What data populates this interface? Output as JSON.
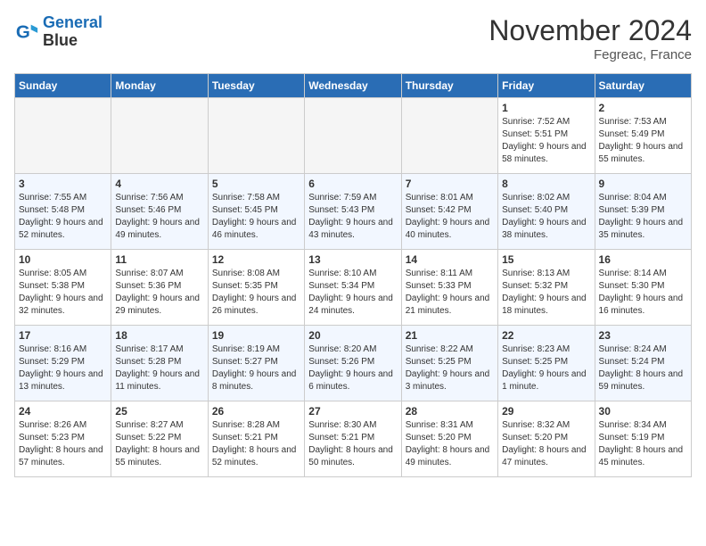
{
  "header": {
    "logo_line1": "General",
    "logo_line2": "Blue",
    "month": "November 2024",
    "location": "Fegreac, France"
  },
  "days_of_week": [
    "Sunday",
    "Monday",
    "Tuesday",
    "Wednesday",
    "Thursday",
    "Friday",
    "Saturday"
  ],
  "weeks": [
    [
      {
        "day": "",
        "empty": true
      },
      {
        "day": "",
        "empty": true
      },
      {
        "day": "",
        "empty": true
      },
      {
        "day": "",
        "empty": true
      },
      {
        "day": "",
        "empty": true
      },
      {
        "day": "1",
        "sunrise": "7:52 AM",
        "sunset": "5:51 PM",
        "daylight": "9 hours and 58 minutes."
      },
      {
        "day": "2",
        "sunrise": "7:53 AM",
        "sunset": "5:49 PM",
        "daylight": "9 hours and 55 minutes."
      }
    ],
    [
      {
        "day": "3",
        "sunrise": "7:55 AM",
        "sunset": "5:48 PM",
        "daylight": "9 hours and 52 minutes."
      },
      {
        "day": "4",
        "sunrise": "7:56 AM",
        "sunset": "5:46 PM",
        "daylight": "9 hours and 49 minutes."
      },
      {
        "day": "5",
        "sunrise": "7:58 AM",
        "sunset": "5:45 PM",
        "daylight": "9 hours and 46 minutes."
      },
      {
        "day": "6",
        "sunrise": "7:59 AM",
        "sunset": "5:43 PM",
        "daylight": "9 hours and 43 minutes."
      },
      {
        "day": "7",
        "sunrise": "8:01 AM",
        "sunset": "5:42 PM",
        "daylight": "9 hours and 40 minutes."
      },
      {
        "day": "8",
        "sunrise": "8:02 AM",
        "sunset": "5:40 PM",
        "daylight": "9 hours and 38 minutes."
      },
      {
        "day": "9",
        "sunrise": "8:04 AM",
        "sunset": "5:39 PM",
        "daylight": "9 hours and 35 minutes."
      }
    ],
    [
      {
        "day": "10",
        "sunrise": "8:05 AM",
        "sunset": "5:38 PM",
        "daylight": "9 hours and 32 minutes."
      },
      {
        "day": "11",
        "sunrise": "8:07 AM",
        "sunset": "5:36 PM",
        "daylight": "9 hours and 29 minutes."
      },
      {
        "day": "12",
        "sunrise": "8:08 AM",
        "sunset": "5:35 PM",
        "daylight": "9 hours and 26 minutes."
      },
      {
        "day": "13",
        "sunrise": "8:10 AM",
        "sunset": "5:34 PM",
        "daylight": "9 hours and 24 minutes."
      },
      {
        "day": "14",
        "sunrise": "8:11 AM",
        "sunset": "5:33 PM",
        "daylight": "9 hours and 21 minutes."
      },
      {
        "day": "15",
        "sunrise": "8:13 AM",
        "sunset": "5:32 PM",
        "daylight": "9 hours and 18 minutes."
      },
      {
        "day": "16",
        "sunrise": "8:14 AM",
        "sunset": "5:30 PM",
        "daylight": "9 hours and 16 minutes."
      }
    ],
    [
      {
        "day": "17",
        "sunrise": "8:16 AM",
        "sunset": "5:29 PM",
        "daylight": "9 hours and 13 minutes."
      },
      {
        "day": "18",
        "sunrise": "8:17 AM",
        "sunset": "5:28 PM",
        "daylight": "9 hours and 11 minutes."
      },
      {
        "day": "19",
        "sunrise": "8:19 AM",
        "sunset": "5:27 PM",
        "daylight": "9 hours and 8 minutes."
      },
      {
        "day": "20",
        "sunrise": "8:20 AM",
        "sunset": "5:26 PM",
        "daylight": "9 hours and 6 minutes."
      },
      {
        "day": "21",
        "sunrise": "8:22 AM",
        "sunset": "5:25 PM",
        "daylight": "9 hours and 3 minutes."
      },
      {
        "day": "22",
        "sunrise": "8:23 AM",
        "sunset": "5:25 PM",
        "daylight": "9 hours and 1 minute."
      },
      {
        "day": "23",
        "sunrise": "8:24 AM",
        "sunset": "5:24 PM",
        "daylight": "8 hours and 59 minutes."
      }
    ],
    [
      {
        "day": "24",
        "sunrise": "8:26 AM",
        "sunset": "5:23 PM",
        "daylight": "8 hours and 57 minutes."
      },
      {
        "day": "25",
        "sunrise": "8:27 AM",
        "sunset": "5:22 PM",
        "daylight": "8 hours and 55 minutes."
      },
      {
        "day": "26",
        "sunrise": "8:28 AM",
        "sunset": "5:21 PM",
        "daylight": "8 hours and 52 minutes."
      },
      {
        "day": "27",
        "sunrise": "8:30 AM",
        "sunset": "5:21 PM",
        "daylight": "8 hours and 50 minutes."
      },
      {
        "day": "28",
        "sunrise": "8:31 AM",
        "sunset": "5:20 PM",
        "daylight": "8 hours and 49 minutes."
      },
      {
        "day": "29",
        "sunrise": "8:32 AM",
        "sunset": "5:20 PM",
        "daylight": "8 hours and 47 minutes."
      },
      {
        "day": "30",
        "sunrise": "8:34 AM",
        "sunset": "5:19 PM",
        "daylight": "8 hours and 45 minutes."
      }
    ]
  ]
}
